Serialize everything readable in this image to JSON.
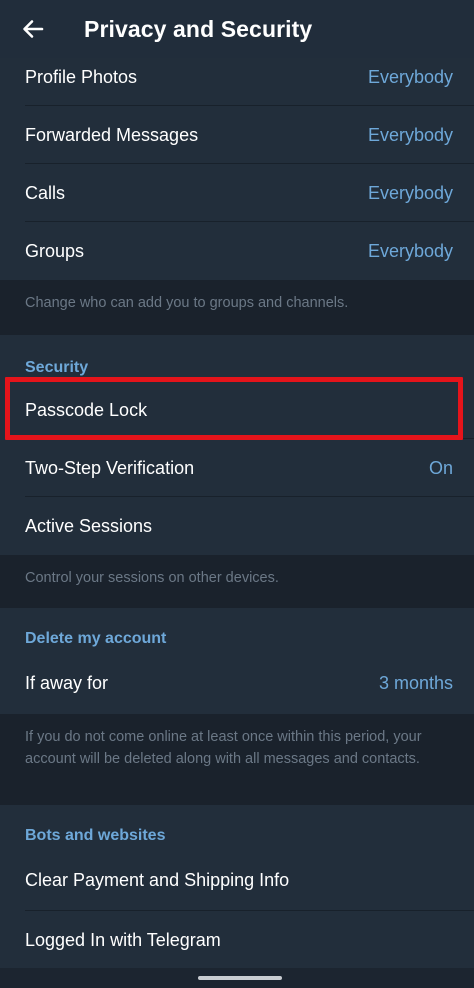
{
  "header": {
    "title": "Privacy and Security",
    "back_icon": "arrow-left-icon"
  },
  "privacy": {
    "rows": [
      {
        "label": "Profile Photos",
        "value": "Everybody"
      },
      {
        "label": "Forwarded Messages",
        "value": "Everybody"
      },
      {
        "label": "Calls",
        "value": "Everybody"
      },
      {
        "label": "Groups",
        "value": "Everybody"
      }
    ],
    "info": "Change who can add you to groups and channels."
  },
  "security": {
    "header": "Security",
    "passcode_label": "Passcode Lock",
    "two_step_label": "Two-Step Verification",
    "two_step_value": "On",
    "sessions_label": "Active Sessions",
    "info": "Control your sessions on other devices."
  },
  "delete_account": {
    "header": "Delete my account",
    "away_label": "If away for",
    "away_value": "3 months",
    "info": "If you do not come online at least once within this period, your account will be deleted along with all messages and contacts."
  },
  "bots": {
    "header": "Bots and websites",
    "payment_label": "Clear Payment and Shipping Info",
    "logged_in_label": "Logged In with Telegram"
  },
  "colors": {
    "background": "#1a222c",
    "card": "#222e3b",
    "accent": "#6ea8d9",
    "highlight": "#e5141b"
  }
}
